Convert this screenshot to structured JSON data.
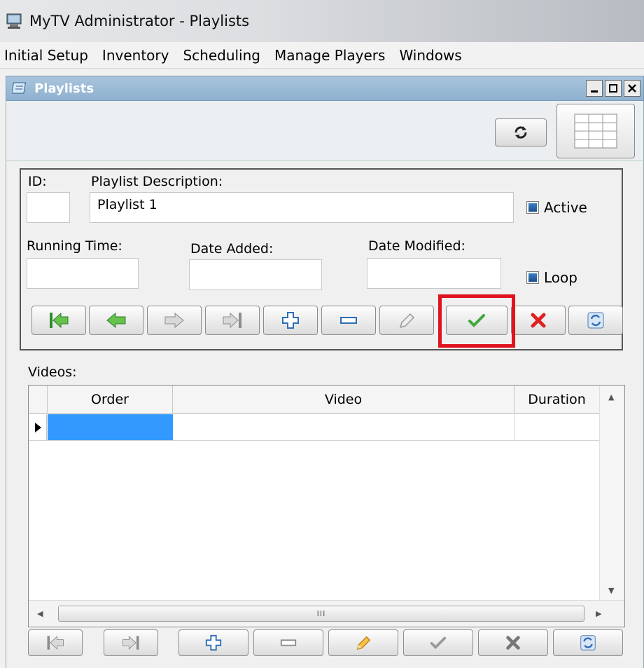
{
  "window": {
    "title": "MyTV Administrator - Playlists"
  },
  "menu": [
    "Initial Setup",
    "Inventory",
    "Scheduling",
    "Manage Players",
    "Windows"
  ],
  "child": {
    "title": "Playlists"
  },
  "form": {
    "id_label": "ID:",
    "id_value": "",
    "description_label": "Playlist Description:",
    "description_value": "Playlist 1",
    "active_label": "Active",
    "active_checked": true,
    "running_time_label": "Running Time:",
    "running_time_value": "",
    "date_added_label": "Date Added:",
    "date_added_value": "",
    "date_modified_label": "Date Modified:",
    "date_modified_value": "",
    "loop_label": "Loop",
    "loop_checked": true
  },
  "nav_buttons": [
    "first-icon",
    "previous-icon",
    "next-icon",
    "last-icon",
    "add-icon",
    "delete-icon",
    "edit-icon",
    "save-icon",
    "cancel-icon",
    "refresh-icon"
  ],
  "videos": {
    "label": "Videos:",
    "columns": [
      "Order",
      "Video",
      "Duration"
    ],
    "rows": [
      {
        "order": "",
        "video": "",
        "duration": ""
      }
    ],
    "scroll_grip": "III"
  },
  "colors": {
    "accent": "#3399ff",
    "highlight": "#e0141e",
    "save": "#3fa83a",
    "cancel": "#e02020"
  }
}
